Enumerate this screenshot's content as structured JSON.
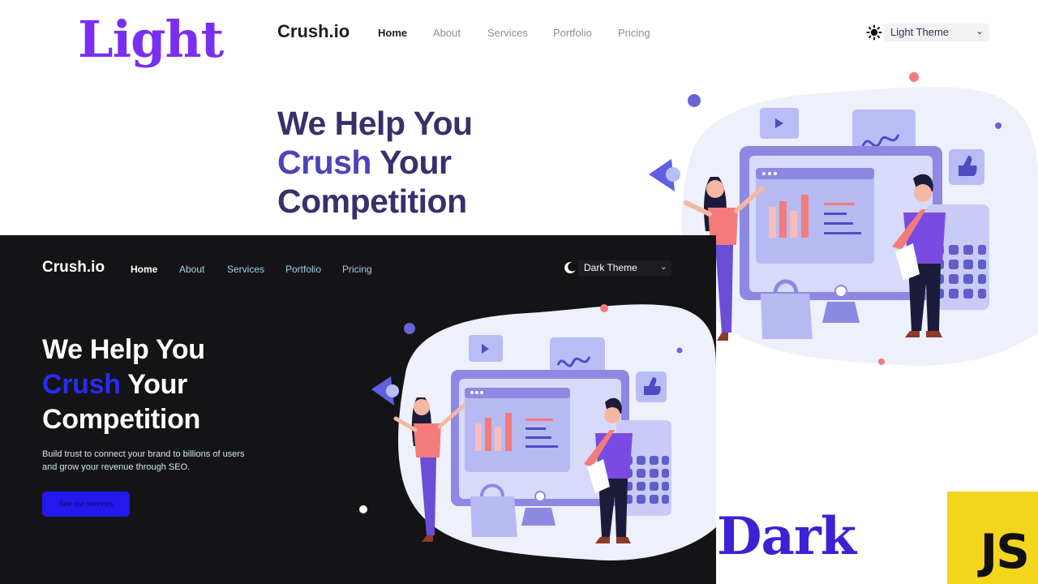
{
  "labels": {
    "light_word": "Light",
    "dark_word": "Dark",
    "js_badge": "JS"
  },
  "light_site": {
    "brand": "Crush.io",
    "nav": [
      "Home",
      "About",
      "Services",
      "Portfolio",
      "Pricing"
    ],
    "theme_select": "Light Theme",
    "hero": {
      "line1": "We Help You",
      "accent": "Crush",
      "line2_rest": " Your",
      "line3": "Competition"
    },
    "colors": {
      "brand_text": "#1c1c2a",
      "hero_text": "#3a2f6b",
      "accent": "#4c43b8"
    }
  },
  "dark_site": {
    "brand": "Crush.io",
    "nav": [
      "Home",
      "About",
      "Services",
      "Portfolio",
      "Pricing"
    ],
    "theme_select": "Dark Theme",
    "hero": {
      "line1": "We Help You",
      "accent": "Crush",
      "line2_rest": " Your",
      "line3": "Competition"
    },
    "description": "Build trust to connect your brand to billions of users and grow your revenue through SEO.",
    "cta": "See our services",
    "colors": {
      "background": "#141416",
      "accent": "#2a2bf0",
      "cta": "#2318ee"
    }
  },
  "icons": {
    "light_toggle": "sun-icon",
    "dark_toggle": "moon-icon",
    "select_arrow": "chevron-down-icon"
  }
}
